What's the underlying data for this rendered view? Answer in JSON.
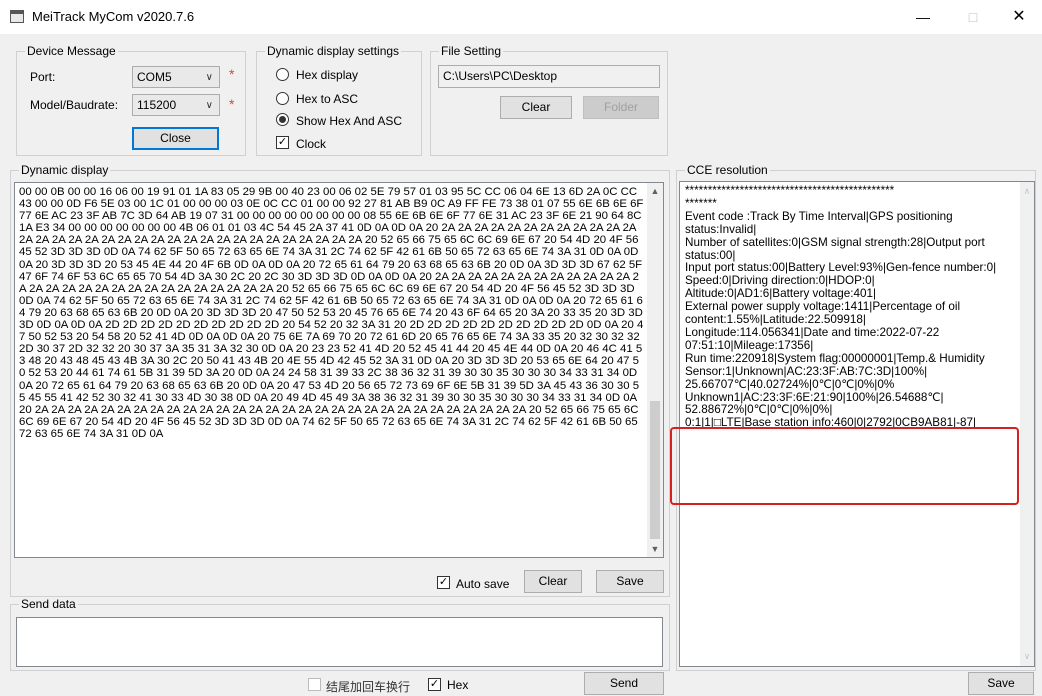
{
  "window": {
    "title": "MeiTrack MyCom v2020.7.6",
    "minimize": "—",
    "maximize": "□",
    "close": "✕"
  },
  "device": {
    "legend": "Device Message",
    "port_label": "Port:",
    "port_value": "COM5",
    "model_label": "Model/Baudrate:",
    "baud_value": "115200",
    "required_mark": "*",
    "close_button": "Close"
  },
  "display_settings": {
    "legend": "Dynamic display settings",
    "options": [
      "Hex display",
      "Hex to ASC",
      "Show Hex And ASC"
    ],
    "selected_index": 2,
    "clock_label": "Clock",
    "clock_checked": true
  },
  "file_setting": {
    "legend": "File Setting",
    "path": "C:\\Users\\PC\\Desktop",
    "clear_button": "Clear",
    "folder_button": "Folder"
  },
  "dynamic_display": {
    "legend": "Dynamic display",
    "content": "00 00 0B 00 00 16 06 00 19 91 01 1A 83 05 29 9B 00 40 23 00 06 02 5E 79 57 01 03 95 5C CC 06 04 6E 13 6D 2A 0C CC 43 00 00 0D F6 5E 03 00 1C 01 00 00 00 03 0E 0C CC 01 00 00 92 27 81 AB B9 0C A9 FF FE 73 38 01 07 55 6E 6B 6E 6F 77 6E AC 23 3F AB 7C 3D 64 AB 19 07 31 00 00 00 00 00 00 00 00 08 55 6E 6B 6E 6F 77 6E 31 AC 23 3F 6E 21 90 64 8C 1A E3 34 00 00 00 00 00 00 00 4B 06 01 01 03 4C 54 45 2A 37 41 0D 0A 0D 0A 20 2A 2A 2A 2A 2A 2A 2A 2A 2A 2A 2A 2A 2A 2A 2A 2A 2A 2A 2A 2A 2A 2A 2A 2A 2A 2A 2A 2A 2A 2A 2A 2A 2A 20 52 65 66 75 65 6C 6C 69 6E 67 20 54 4D 20 4F 56 45 52 3D 3D 3D 0D 0A 74 62 5F 50 65 72 63 65 6E 74 3A 31 2C 74 62 5F 42 61 6B 50 65 72 63 65 6E 74 3A 31 0D 0A 0D 0A 20 3D 3D 3D 20 53 45 4E 44 20 4F 6B 0D 0A 0D 0A 20 72 65 61 64 79 20 63 68 65 63 6B 20 0D 0A 3D 3D 3D 67 62 5F 47 6F 74 6F 53 6C 65 65 70 54 4D 3A 30 2C 20 2C 30 3D 3D 3D 0D 0A 0D 0A 20 2A 2A 2A 2A 2A 2A 2A 2A 2A 2A 2A 2A 2A 2A 2A 2A 2A 2A 2A 2A 2A 2A 2A 2A 2A 2A 2A 2A 20 52 65 66 75 65 6C 6C 69 6E 67 20 54 4D 20 4F 56 45 52 3D 3D 3D 0D 0A 74 62 5F 50 65 72 63 65 6E 74 3A 31 2C 74 62 5F 42 61 6B 50 65 72 63 65 6E 74 3A 31 0D 0A 0D 0A 20 72 65 61 64 79 20 63 68 65 63 6B 20 0D 0A 20 3D 3D 3D 20 47 50 52 53 20 45 76 65 6E 74 20 43 6F 64 65 20 3A 20 33 35 20 3D 3D 3D 0D 0A 0D 0A 2D 2D 2D 2D 2D 2D 2D 2D 2D 2D 20 54 52 20 32 3A 31 20 2D 2D 2D 2D 2D 2D 2D 2D 2D 2D 0D 0A 20 47 50 52 53 20 54 58 20 52 41 4D 0D 0A 0D 0A 20 75 6E 7A 69 70 20 72 61 6D 20 65 76 65 6E 74 3A 33 35 20 32 30 32 32 2D 30 37 2D 32 32 20 30 37 3A 35 31 3A 32 30 0D 0A 20 23 23 52 41 4D 20 52 45 41 44 20 45 4E 44 0D 0A 20 46 4C 41 53 48 20 43 48 45 43 4B 3A 30 2C 20 50 41 43 4B 20 4E 55 4D 42 45 52 3A 31 0D 0A 20 3D 3D 3D 20 53 65 6E 64 20 47 50 52 53 20 44 61 74 61 5B 31 39 5D 3A 20 0D 0A 24 24 58 31 39 33 2C 38 36 32 31 39 30 30 35 30 30 30 34 33 31 34 0D 0A 20 72 65 61 64 79 20 63 68 65 63 6B 20 0D 0A 20 47 53 4D 20 56 65 72 73 69 6F 6E 5B 31 39 5D 3A 45 43 36 30 30 55 45 55 41 42 52 30 32 41 30 33 4D 30 38 0D 0A 20 49 4D 45 49 3A 38 36 32 31 39 30 30 35 30 30 30 34 33 31 34 0D 0A 20 2A 2A 2A 2A 2A 2A 2A 2A 2A 2A 2A 2A 2A 2A 2A 2A 2A 2A 2A 2A 2A 2A 2A 2A 2A 2A 2A 2A 2A 2A 20 52 65 66 75 65 6C 6C 69 6E 67 20 54 4D 20 4F 56 45 52 3D 3D 3D 0D 0A 74 62 5F 50 65 72 63 65 6E 74 3A 31 2C 74 62 5F 42 61 6B 50 65 72 63 65 6E 74 3A 31 0D 0A",
    "auto_save_label": "Auto save",
    "auto_save_checked": true,
    "clear_button": "Clear",
    "save_button": "Save"
  },
  "send_data": {
    "legend": "Send data",
    "value": "",
    "append_crlf_label": "结尾加回车换行",
    "append_crlf_checked": false,
    "hex_label": "Hex",
    "hex_checked": true,
    "send_button": "Send"
  },
  "cce": {
    "legend": "CCE resolution",
    "content": "**********************************************\n*******\nEvent code :Track By Time Interval|GPS positioning status:Invalid|\nNumber of satellites:0|GSM signal strength:28|Output port status:00|\nInput port status:00|Battery Level:93%|Gen-fence number:0|\nSpeed:0|Driving direction:0|HDOP:0|\nAltitude:0|AD1:6|Battery voltage:401|\nExternal power supply voltage:1411|Percentage of oil content:1.55%|Latitude:22.509918|\nLongitude:114.056341|Date and time:2022-07-22 07:51:10|Mileage:17356|\nRun time:220918|System flag:00000001|Temp.& Humidity Sensor:1|Unknown|AC:23:3F:AB:7C:3D|100%|\n25.66707℃|40.02724%|0℃|0℃|0%|0%\nUnknown1|AC:23:3F:6E:21:90|100%|26.54688℃|\n52.88672%|0℃|0℃|0%|0%|\n0:1|1|□LTE|Base station info:460|0|2792|0CB9AB81|-87|",
    "save_button": "Save"
  }
}
